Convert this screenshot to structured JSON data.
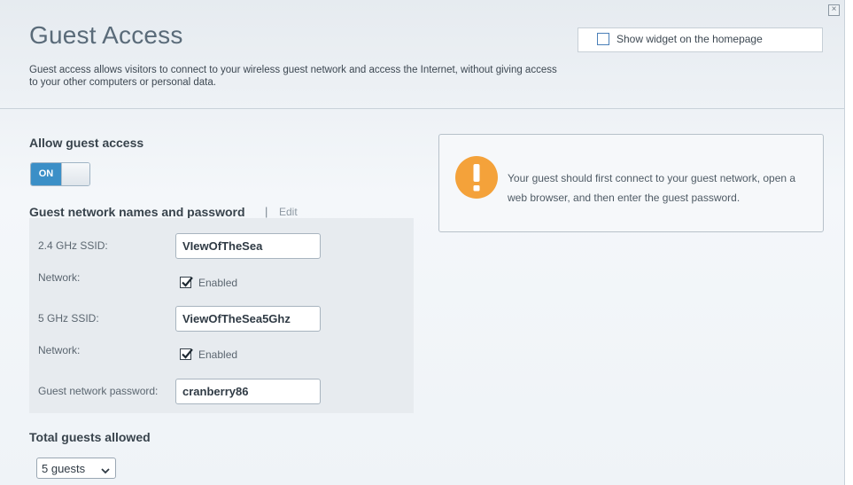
{
  "window": {
    "close_glyph": "×"
  },
  "header": {
    "title": "Guest Access",
    "description": "Guest access allows visitors to connect to your wireless guest network and access the Internet, without giving access to your other computers or personal data.",
    "widget_checkbox_label": "Show widget on the homepage",
    "widget_checked": false
  },
  "allow_guest": {
    "title": "Allow guest access",
    "toggle_label": "ON",
    "enabled": true
  },
  "networks": {
    "title": "Guest network names and password",
    "separator": "|",
    "edit_label": "Edit",
    "ssid24_label": "2.4 GHz SSID:",
    "ssid24_value": "VIewOfTheSea",
    "network24_label": "Network:",
    "network24_checkbox_label": "Enabled",
    "network24_enabled": true,
    "ssid5_label": "5 GHz SSID:",
    "ssid5_value": "ViewOfTheSea5Ghz",
    "network5_label": "Network:",
    "network5_checkbox_label": "Enabled",
    "network5_enabled": true,
    "password_label": "Guest network password:",
    "password_value": "cranberry86"
  },
  "guests": {
    "title": "Total guests allowed",
    "selected": "5 guests"
  },
  "info": {
    "icon": "warning-icon",
    "text": "Your guest should first connect to your guest network, open a web browser, and then enter the guest password."
  },
  "colors": {
    "accent": "#3b8fc7",
    "warning": "#f4a23a",
    "title": "#5a6b79"
  }
}
